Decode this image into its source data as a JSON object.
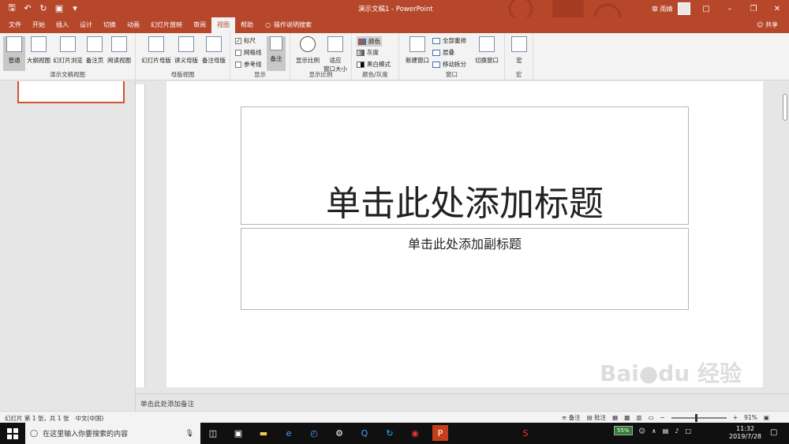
{
  "titlebar": {
    "document_title": "演示文稿1 - PowerPoint",
    "user_name": "章 雨婧",
    "qat": [
      "save-icon",
      "undo-icon",
      "redo-icon",
      "present-icon",
      "customize-icon"
    ]
  },
  "tabs": [
    "文件",
    "开始",
    "插入",
    "设计",
    "切换",
    "动画",
    "幻灯片放映",
    "审阅",
    "视图",
    "帮助"
  ],
  "active_tab": "视图",
  "tell_me": "操作说明搜索",
  "share": "共享",
  "ribbon": {
    "groups": {
      "presentation_views": {
        "label": "演示文稿视图",
        "buttons": [
          "普通",
          "大纲视图",
          "幻灯片浏览",
          "备注页",
          "阅读视图"
        ]
      },
      "master_views": {
        "label": "母版视图",
        "buttons": [
          "幻灯片母版",
          "讲义母版",
          "备注母版"
        ]
      },
      "show": {
        "label": "显示",
        "checks": [
          "标尺",
          "网格线",
          "参考线"
        ],
        "notes": "备注"
      },
      "zoom": {
        "label": "显示比例",
        "zoom": "显示比例",
        "fit_line1": "适应",
        "fit_line2": "窗口大小"
      },
      "color": {
        "label": "颜色/灰度",
        "options": [
          "颜色",
          "灰度",
          "黑白模式"
        ]
      },
      "window": {
        "label": "窗口",
        "new_window": "新建窗口",
        "options": [
          "全部重排",
          "层叠",
          "移动拆分"
        ],
        "switch": "切换窗口"
      },
      "macros": {
        "label": "宏",
        "macros": "宏"
      }
    }
  },
  "slide": {
    "title_placeholder": "单击此处添加标题",
    "subtitle_placeholder": "单击此处添加副标题"
  },
  "notes_placeholder": "单击此处添加备注",
  "status": {
    "slide_info": "幻灯片 第 1 张，共 1 张",
    "language": "中文(中国)",
    "notes": "备注",
    "comments": "批注",
    "zoom": "91%"
  },
  "taskbar": {
    "search_placeholder": "在这里输入你要搜索的内容",
    "battery": "55%",
    "time": "11:32",
    "date": "2019/7/28"
  },
  "colors": {
    "accent": "#b7472a",
    "thumb_border": "#d35230"
  }
}
